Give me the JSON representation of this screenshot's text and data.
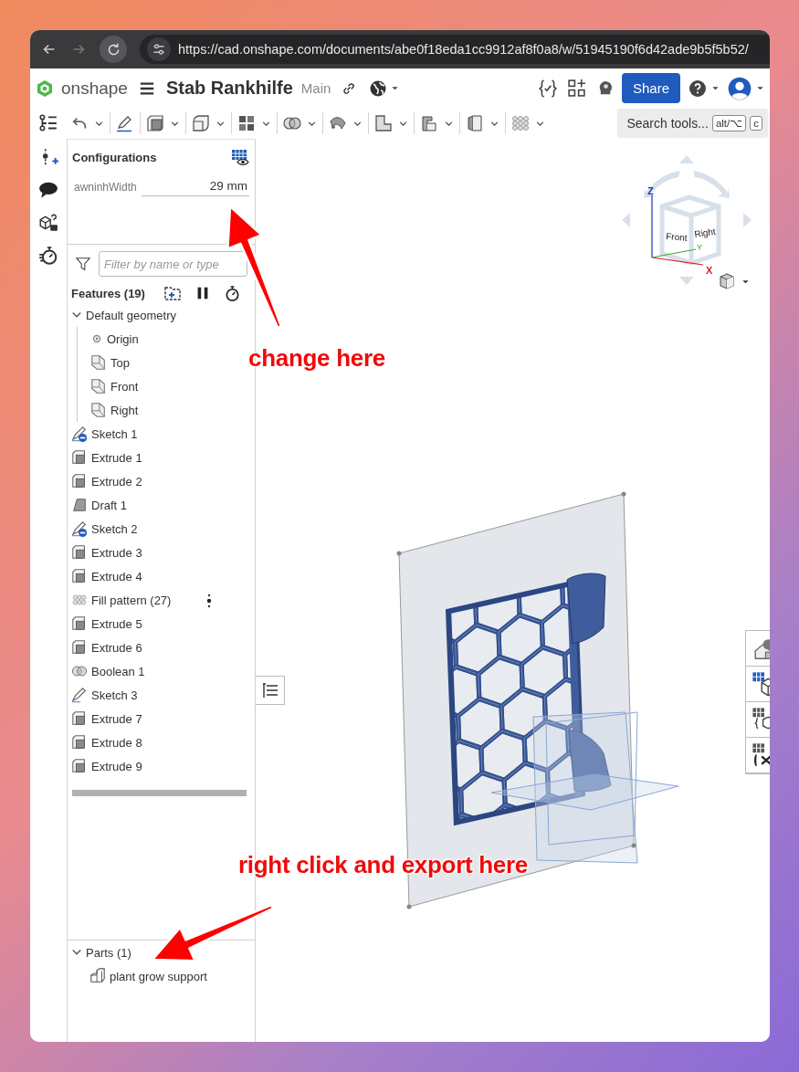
{
  "browser": {
    "url": "https://cad.onshape.com/documents/abe0f18eda1cc9912af8f0a8/w/51945190f6d42ade9b5f5b52/"
  },
  "app": {
    "logo_text": "onshape",
    "document_title": "Stab Rankhilfe",
    "branch": "Main",
    "share_button": "Share"
  },
  "toolbar": {
    "search_label": "Search tools...",
    "shortcut_keys": [
      "alt/⌥",
      "c"
    ]
  },
  "configurations": {
    "title": "Configurations",
    "parameters": [
      {
        "name": "awninhWidth",
        "value": "29 mm"
      }
    ]
  },
  "filter": {
    "placeholder": "Filter by name or type"
  },
  "feature_tree": {
    "title": "Features (19)",
    "default_geometry": {
      "label": "Default geometry",
      "expanded": true,
      "children": [
        {
          "label": "Origin",
          "kind": "origin"
        },
        {
          "label": "Top",
          "kind": "plane"
        },
        {
          "label": "Front",
          "kind": "plane"
        },
        {
          "label": "Right",
          "kind": "plane"
        }
      ]
    },
    "items": [
      {
        "label": "Sketch 1",
        "kind": "sketch",
        "badged": true,
        "hovered": false
      },
      {
        "label": "Extrude 1",
        "kind": "extrude",
        "badged": false,
        "hovered": false
      },
      {
        "label": "Extrude 2",
        "kind": "extrude",
        "badged": false,
        "hovered": false
      },
      {
        "label": "Draft 1",
        "kind": "draft",
        "badged": false,
        "hovered": false
      },
      {
        "label": "Sketch 2",
        "kind": "sketch",
        "badged": true,
        "hovered": false
      },
      {
        "label": "Extrude 3",
        "kind": "extrude",
        "badged": false,
        "hovered": false
      },
      {
        "label": "Extrude 4",
        "kind": "extrude",
        "badged": false,
        "hovered": false
      },
      {
        "label": "Fill pattern (27)",
        "kind": "pattern",
        "badged": false,
        "hovered": true
      },
      {
        "label": "Extrude 5",
        "kind": "extrude",
        "badged": false,
        "hovered": false
      },
      {
        "label": "Extrude 6",
        "kind": "extrude",
        "badged": false,
        "hovered": false
      },
      {
        "label": "Boolean 1",
        "kind": "boolean",
        "badged": false,
        "hovered": false
      },
      {
        "label": "Sketch 3",
        "kind": "sketch",
        "badged": false,
        "hovered": false
      },
      {
        "label": "Extrude 7",
        "kind": "extrude",
        "badged": false,
        "hovered": false
      },
      {
        "label": "Extrude 8",
        "kind": "extrude",
        "badged": false,
        "hovered": false
      },
      {
        "label": "Extrude 9",
        "kind": "extrude",
        "badged": false,
        "hovered": false
      }
    ]
  },
  "parts": {
    "label": "Parts (1)",
    "expanded": true,
    "children": [
      {
        "label": "plant grow support"
      }
    ]
  },
  "viewcube": {
    "faces": [
      "Front",
      "Right"
    ],
    "axes": [
      "Z",
      "Y",
      "X"
    ]
  },
  "annotations": [
    {
      "text": "change here"
    },
    {
      "text": "right click and export here"
    }
  ]
}
